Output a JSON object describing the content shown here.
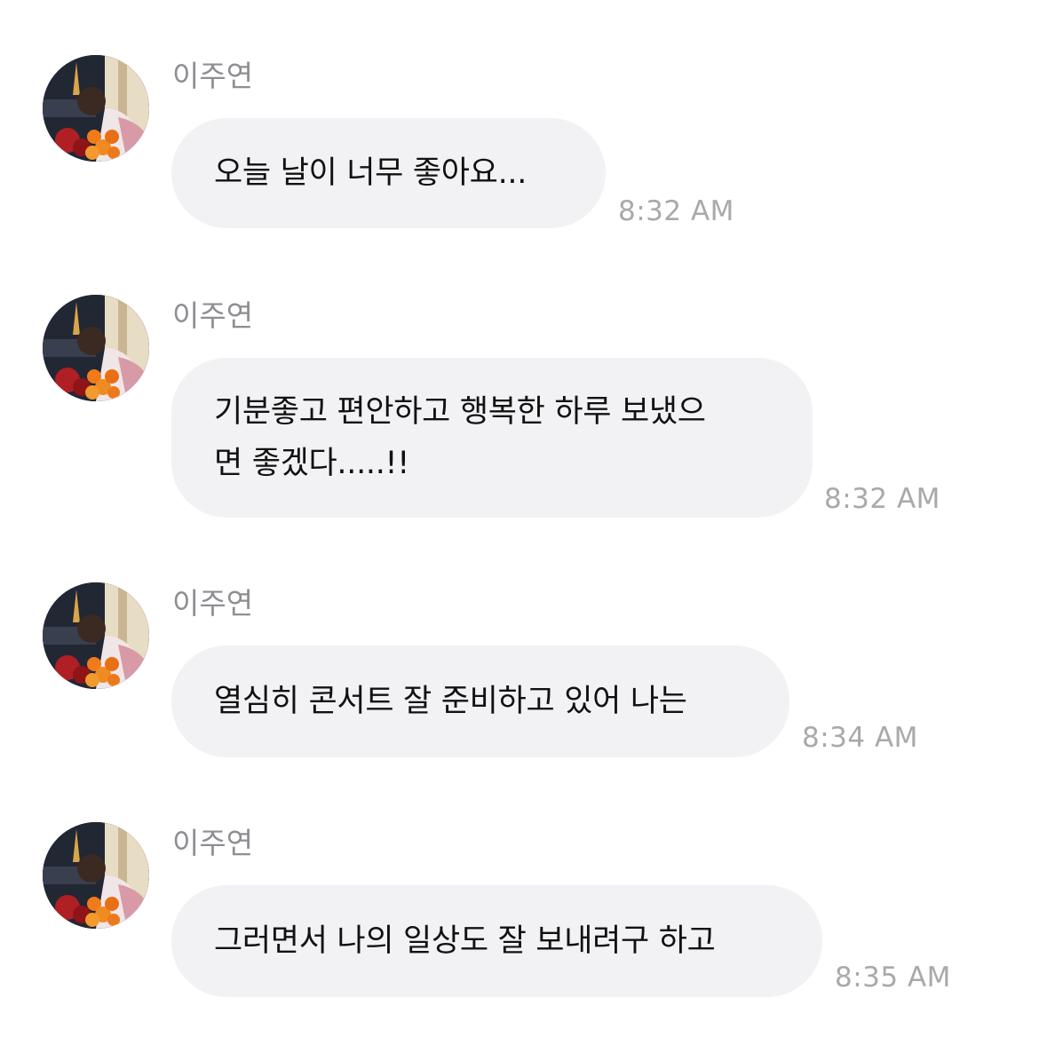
{
  "messages": [
    {
      "sender": "이주연",
      "text": "오늘 날이 너무 좋아요...",
      "time": "8:32 AM"
    },
    {
      "sender": "이주연",
      "text": "기분좋고 편안하고 행복한 하루 보냈으\n면 좋겠다.....!!",
      "time": "8:32 AM"
    },
    {
      "sender": "이주연",
      "text": "열심히 콘서트 잘 준비하고 있어 나는",
      "time": "8:34 AM"
    },
    {
      "sender": "이주연",
      "text": "그러면서 나의 일상도 잘 보내려구 하고",
      "time": "8:35 AM"
    }
  ],
  "colors": {
    "bubble_bg": "#f2f2f5",
    "sender": "#8e8e93",
    "time": "#a9a9ad",
    "text": "#111111"
  },
  "icons": {
    "avatar": "profile-photo-avatar"
  }
}
